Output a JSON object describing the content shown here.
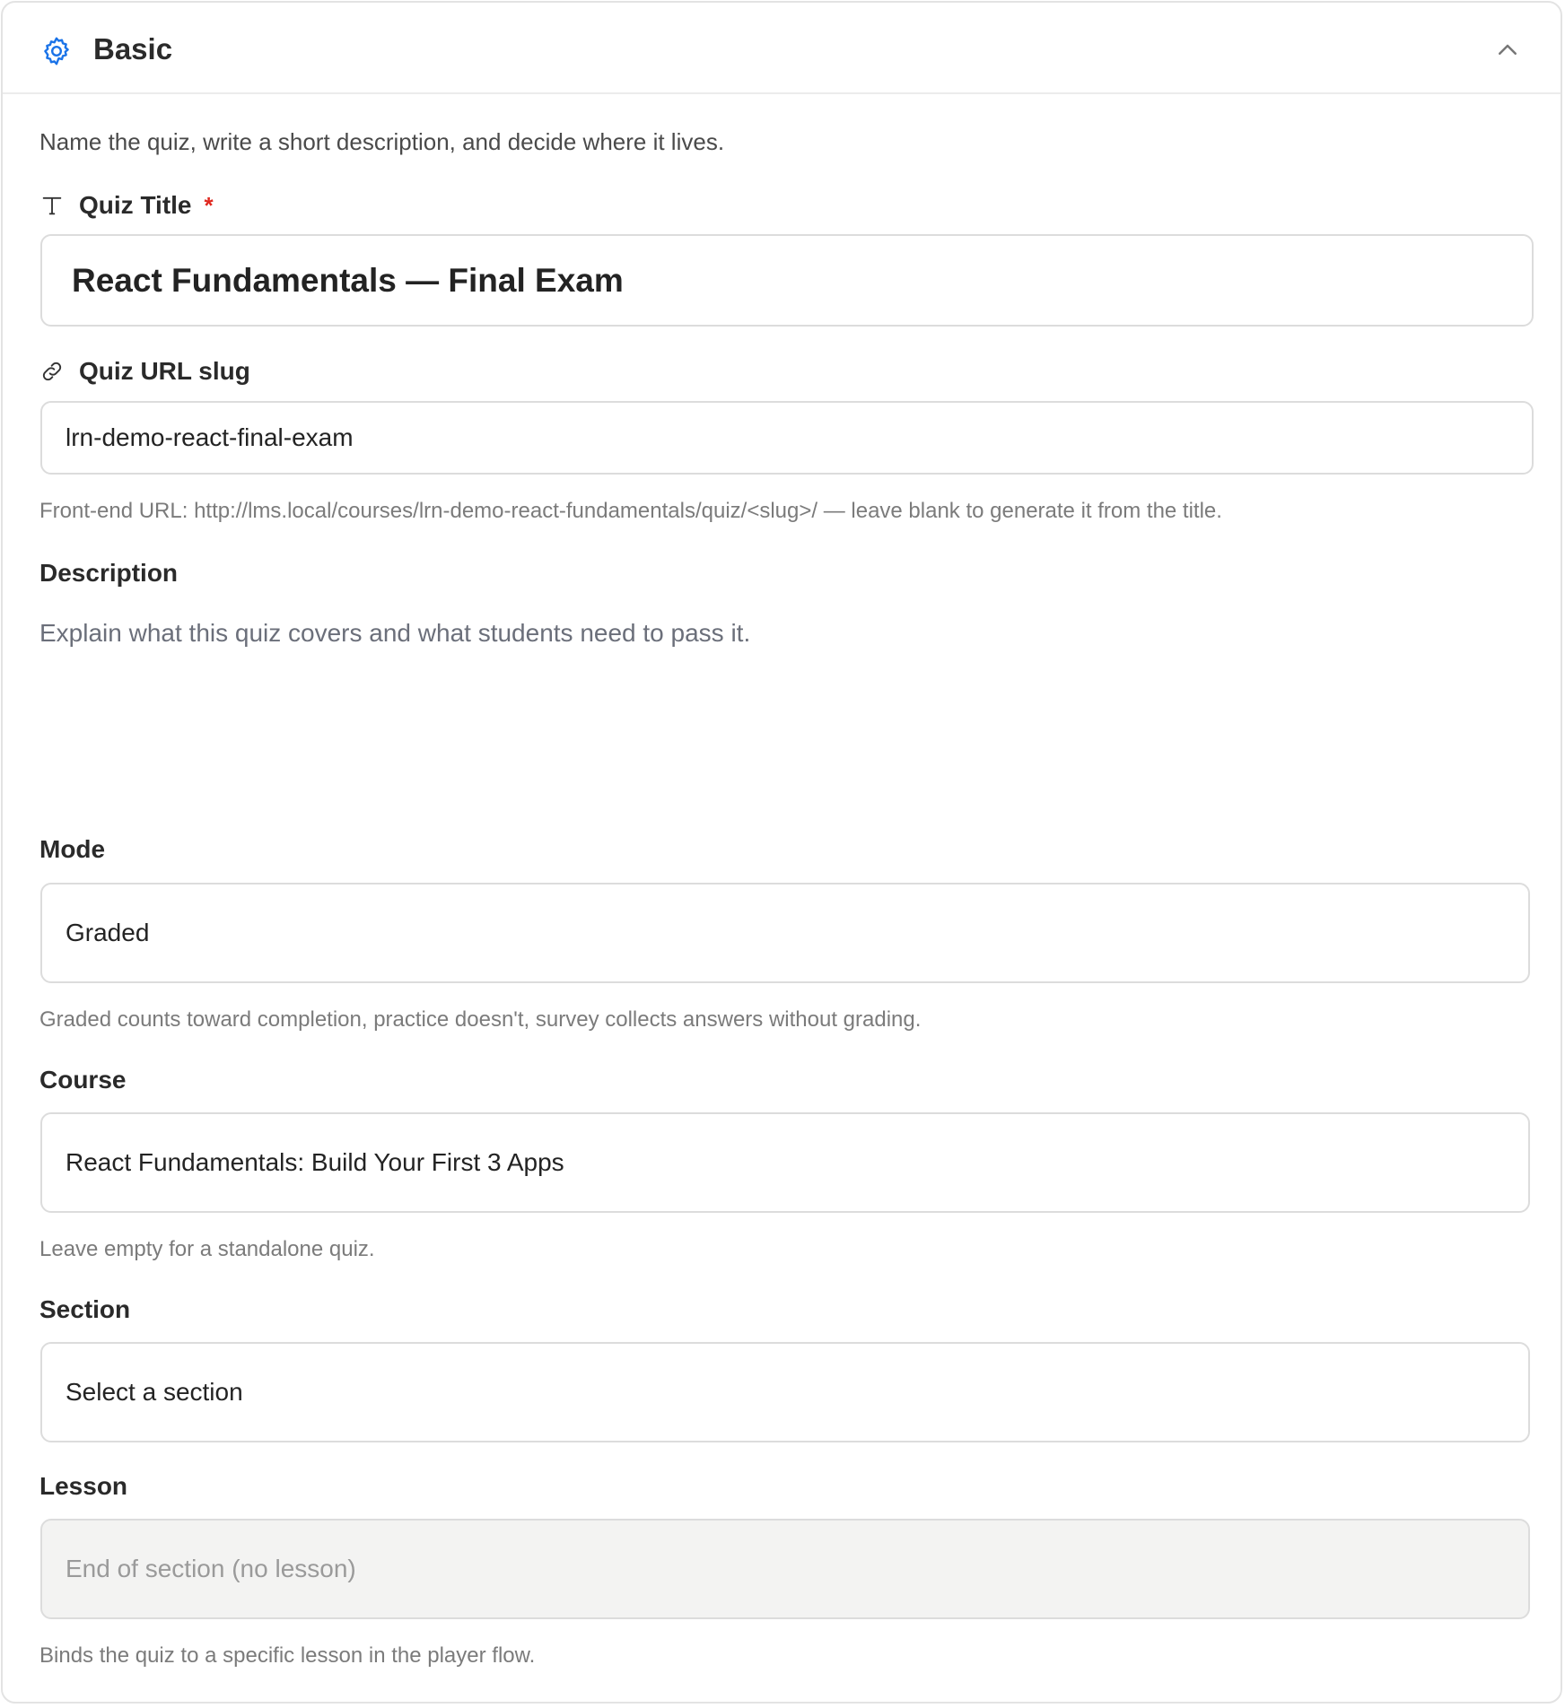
{
  "panel": {
    "title": "Basic",
    "intro": "Name the quiz, write a short description, and decide where it lives."
  },
  "icons": {
    "panel_icon": "gear-icon",
    "collapse_icon": "chevron-up-icon",
    "title_icon": "text-type-icon",
    "slug_icon": "link-icon"
  },
  "colors": {
    "accent": "#1a73e8",
    "required": "#e0281f",
    "border": "#dcdcdc",
    "disabled_bg": "#f3f3f2"
  },
  "quiz_title": {
    "label": "Quiz Title",
    "required_mark": "*",
    "value": "React Fundamentals — Final Exam"
  },
  "slug": {
    "label": "Quiz URL slug",
    "value": "lrn-demo-react-final-exam",
    "help": "Front-end URL: http://lms.local/courses/lrn-demo-react-fundamentals/quiz/<slug>/ — leave blank to generate it from the title."
  },
  "description": {
    "label": "Description",
    "placeholder": "Explain what this quiz covers and what students need to pass it."
  },
  "mode": {
    "label": "Mode",
    "value": "Graded",
    "help": "Graded counts toward completion, practice doesn't, survey collects answers without grading."
  },
  "course": {
    "label": "Course",
    "value": "React Fundamentals: Build Your First 3 Apps",
    "help": "Leave empty for a standalone quiz."
  },
  "section": {
    "label": "Section",
    "value": "Select a section"
  },
  "lesson": {
    "label": "Lesson",
    "value": "End of section (no lesson)",
    "help": "Binds the quiz to a specific lesson in the player flow."
  }
}
